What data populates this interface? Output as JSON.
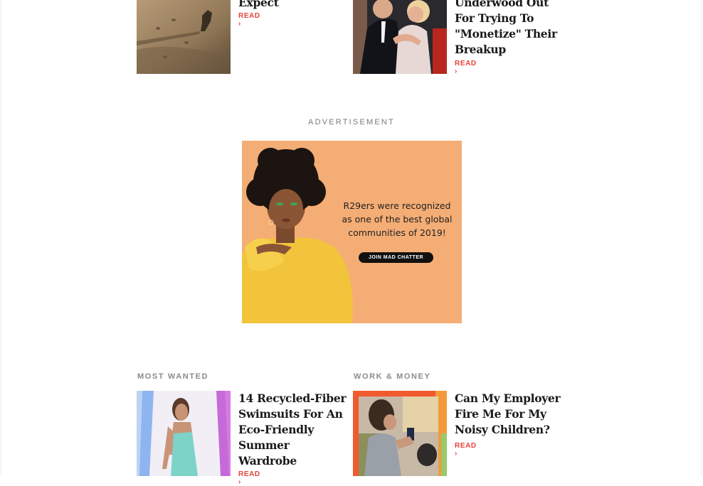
{
  "top_row": {
    "left": {
      "title": "Expect",
      "read": "READ ›"
    },
    "right": {
      "title_lines": [
        "Underwood Out",
        "For Trying To",
        "\"Monetize\" Their",
        "Breakup"
      ],
      "read": "READ ›"
    }
  },
  "ad": {
    "label": "ADVERTISEMENT",
    "text_lines": [
      "R29ers were recognized",
      "as one of the best global",
      "communities of 2019!"
    ],
    "button_label": "JOIN MAD CHATTER"
  },
  "sections": {
    "most_wanted": {
      "kicker": "MOST WANTED",
      "title_lines": [
        "14 Recycled-Fiber",
        "Swimsuits For An",
        "Eco-Friendly",
        "Summer",
        "Wardrobe"
      ],
      "read": "READ ›"
    },
    "work_money": {
      "kicker": "WORK & MONEY",
      "title_lines": [
        "Can My Employer",
        "Fire Me For My",
        "Noisy Children?"
      ],
      "read": "READ ›"
    }
  },
  "colors": {
    "accent_read": "#e8413b",
    "ad_background": "#f4ad75",
    "kicker_gray": "#8b8b8b"
  }
}
